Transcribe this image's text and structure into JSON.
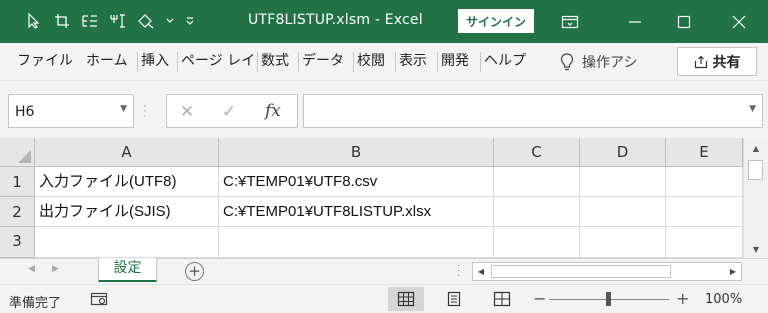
{
  "window": {
    "title": "UTF8LISTUP.xlsm  -  Excel",
    "signin_label": "サインイン",
    "accent": "#217346"
  },
  "qat_icons": [
    "cursor-icon",
    "crop-icon",
    "tree-icon",
    "tracer-icon",
    "shape-icon",
    "dropdown-icon",
    "customize-icon"
  ],
  "ribbon": {
    "tabs": [
      "ファイル",
      "ホーム",
      "挿入",
      "ページ レイ",
      "数式",
      "データ",
      "校閲",
      "表示",
      "開発",
      "ヘルプ"
    ],
    "tell_me": "操作アシ",
    "share_label": "共有"
  },
  "formula_bar": {
    "name_box": "H6",
    "fx_label": "fx",
    "formula": ""
  },
  "grid": {
    "columns": [
      "A",
      "B",
      "C",
      "D",
      "E"
    ],
    "rows": [
      {
        "num": "1",
        "cells": [
          "入力ファイル(UTF8)",
          "C:¥TEMP01¥UTF8.csv",
          "",
          "",
          ""
        ]
      },
      {
        "num": "2",
        "cells": [
          "出力ファイル(SJIS)",
          "C:¥TEMP01¥UTF8LISTUP.xlsx",
          "",
          "",
          ""
        ]
      },
      {
        "num": "3",
        "cells": [
          "",
          "",
          "",
          "",
          ""
        ]
      }
    ]
  },
  "sheets": {
    "tabs": [
      "設定"
    ],
    "active": "設定"
  },
  "status": {
    "ready": "準備完了",
    "zoom": "100%",
    "zoom_level": 1.0
  }
}
